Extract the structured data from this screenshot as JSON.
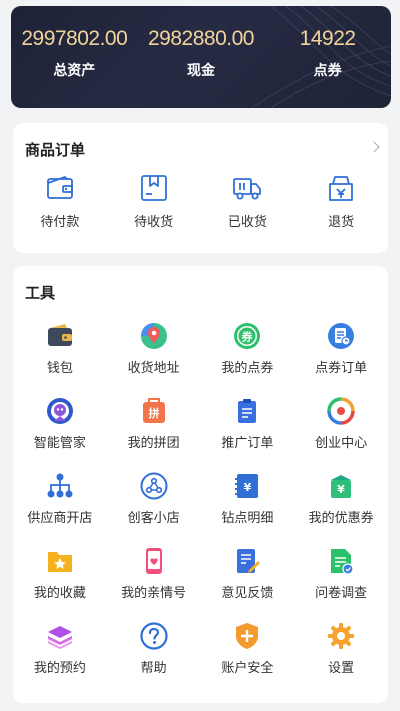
{
  "assets": [
    {
      "value": "2997802.00",
      "label": "总资产"
    },
    {
      "value": "2982880.00",
      "label": "现金"
    },
    {
      "value": "14922",
      "label": "点券"
    }
  ],
  "orders": {
    "title": "商品订单",
    "items": [
      {
        "label": "待付款",
        "icon": "wallet-icon"
      },
      {
        "label": "待收货",
        "icon": "package-icon"
      },
      {
        "label": "已收货",
        "icon": "truck-icon"
      },
      {
        "label": "退货",
        "icon": "return-icon"
      }
    ]
  },
  "tools": {
    "title": "工具",
    "items": [
      {
        "label": "钱包",
        "icon": "wallet-icon"
      },
      {
        "label": "收货地址",
        "icon": "map-pin-icon"
      },
      {
        "label": "我的点券",
        "icon": "coupon-icon"
      },
      {
        "label": "点券订单",
        "icon": "coupon-order-icon"
      },
      {
        "label": "智能管家",
        "icon": "robot-icon"
      },
      {
        "label": "我的拼团",
        "icon": "group-buy-icon"
      },
      {
        "label": "推广订单",
        "icon": "clipboard-icon"
      },
      {
        "label": "创业中心",
        "icon": "startup-icon"
      },
      {
        "label": "供应商开店",
        "icon": "network-icon"
      },
      {
        "label": "创客小店",
        "icon": "shop-icon"
      },
      {
        "label": "钻点明细",
        "icon": "ledger-icon"
      },
      {
        "label": "我的优惠券",
        "icon": "voucher-icon"
      },
      {
        "label": "我的收藏",
        "icon": "favorite-folder-icon"
      },
      {
        "label": "我的亲情号",
        "icon": "phone-heart-icon"
      },
      {
        "label": "意见反馈",
        "icon": "feedback-icon"
      },
      {
        "label": "问卷调查",
        "icon": "survey-icon"
      },
      {
        "label": "我的预约",
        "icon": "layers-icon"
      },
      {
        "label": "帮助",
        "icon": "help-icon"
      },
      {
        "label": "账户安全",
        "icon": "shield-icon"
      },
      {
        "label": "设置",
        "icon": "gear-icon"
      }
    ]
  },
  "colors": {
    "header_bg": "#1f2336",
    "asset_value": "#f3d39a",
    "accent_blue": "#2f6fd6"
  }
}
